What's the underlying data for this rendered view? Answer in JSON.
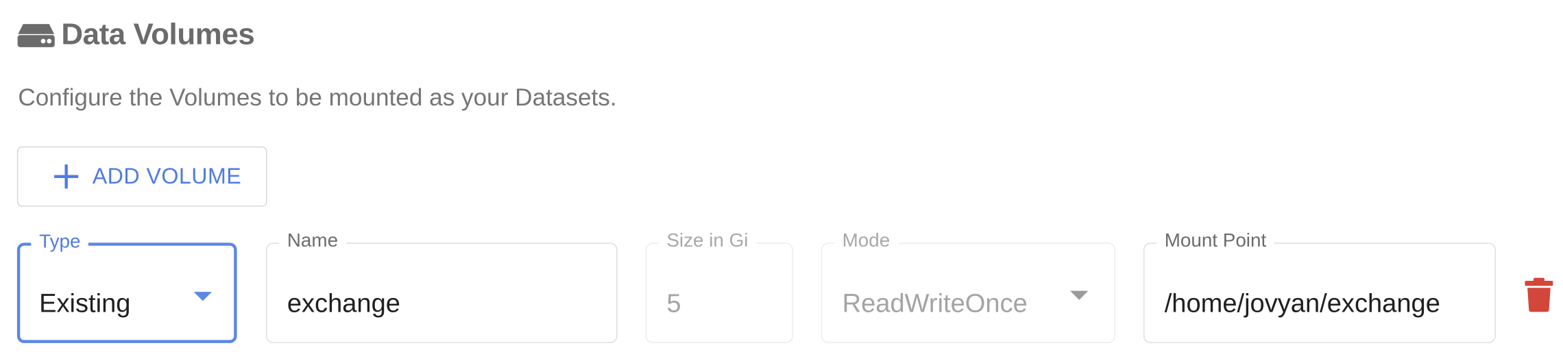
{
  "section": {
    "icon": "storage-drive-icon",
    "title": "Data Volumes",
    "description": "Configure the Volumes to be mounted as your Datasets."
  },
  "add_button": {
    "icon": "plus-icon",
    "label": "ADD VOLUME"
  },
  "volume_row": {
    "type": {
      "label": "Type",
      "value": "Existing"
    },
    "name": {
      "label": "Name",
      "value": "exchange"
    },
    "size": {
      "label": "Size in Gi",
      "value": "5"
    },
    "mode": {
      "label": "Mode",
      "value": "ReadWriteOnce"
    },
    "mount_point": {
      "label": "Mount Point",
      "value": "/home/jovyan/exchange"
    },
    "delete_icon": "trash-icon"
  },
  "colors": {
    "accent": "#4f7ce0",
    "delete": "#d2473a",
    "heading": "#6b6b6b"
  }
}
